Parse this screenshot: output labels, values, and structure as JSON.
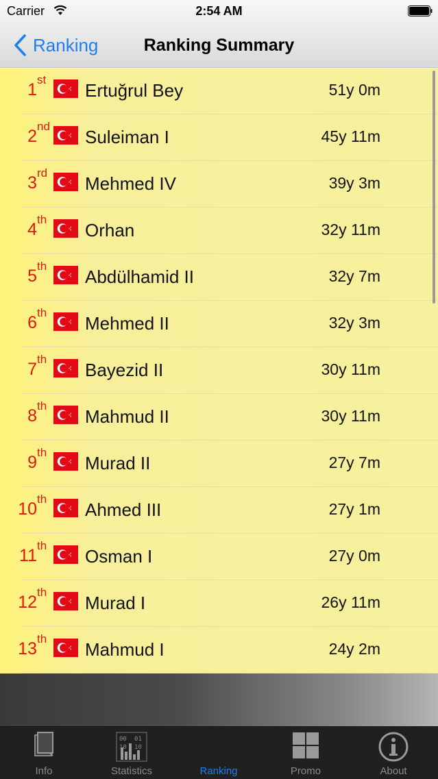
{
  "status_bar": {
    "carrier": "Carrier",
    "time": "2:54 AM"
  },
  "nav": {
    "back_label": "Ranking",
    "title": "Ranking Summary"
  },
  "rows": [
    {
      "rank": "1",
      "suffix": "st",
      "name": "Ertuğrul Bey",
      "duration": "51y 0m"
    },
    {
      "rank": "2",
      "suffix": "nd",
      "name": "Suleiman I",
      "duration": "45y 11m"
    },
    {
      "rank": "3",
      "suffix": "rd",
      "name": "Mehmed IV",
      "duration": "39y 3m"
    },
    {
      "rank": "4",
      "suffix": "th",
      "name": "Orhan",
      "duration": "32y 11m"
    },
    {
      "rank": "5",
      "suffix": "th",
      "name": "Abdülhamid II",
      "duration": "32y 7m"
    },
    {
      "rank": "6",
      "suffix": "th",
      "name": "Mehmed II",
      "duration": "32y 3m"
    },
    {
      "rank": "7",
      "suffix": "th",
      "name": "Bayezid II",
      "duration": "30y 11m"
    },
    {
      "rank": "8",
      "suffix": "th",
      "name": "Mahmud II",
      "duration": "30y 11m"
    },
    {
      "rank": "9",
      "suffix": "th",
      "name": "Murad II",
      "duration": "27y 7m"
    },
    {
      "rank": "10",
      "suffix": "th",
      "name": "Ahmed III",
      "duration": "27y 1m"
    },
    {
      "rank": "11",
      "suffix": "th",
      "name": "Osman I",
      "duration": "27y 0m"
    },
    {
      "rank": "12",
      "suffix": "th",
      "name": "Murad I",
      "duration": "26y 11m"
    },
    {
      "rank": "13",
      "suffix": "th",
      "name": "Mahmud I",
      "duration": "24y 2m"
    }
  ],
  "tabs": [
    {
      "label": "Info",
      "icon": "book-icon"
    },
    {
      "label": "Statistics",
      "icon": "statistics-icon"
    },
    {
      "label": "Ranking",
      "icon": "ranking-icon",
      "active": true
    },
    {
      "label": "Promo",
      "icon": "grid-icon"
    },
    {
      "label": "About",
      "icon": "info-icon"
    }
  ],
  "colors": {
    "accent": "#1b7ff0",
    "rank_red": "#e0160f",
    "flag_red": "#e30a17",
    "list_bg": "#f6f19e",
    "tabbar_bg": "#202020"
  }
}
